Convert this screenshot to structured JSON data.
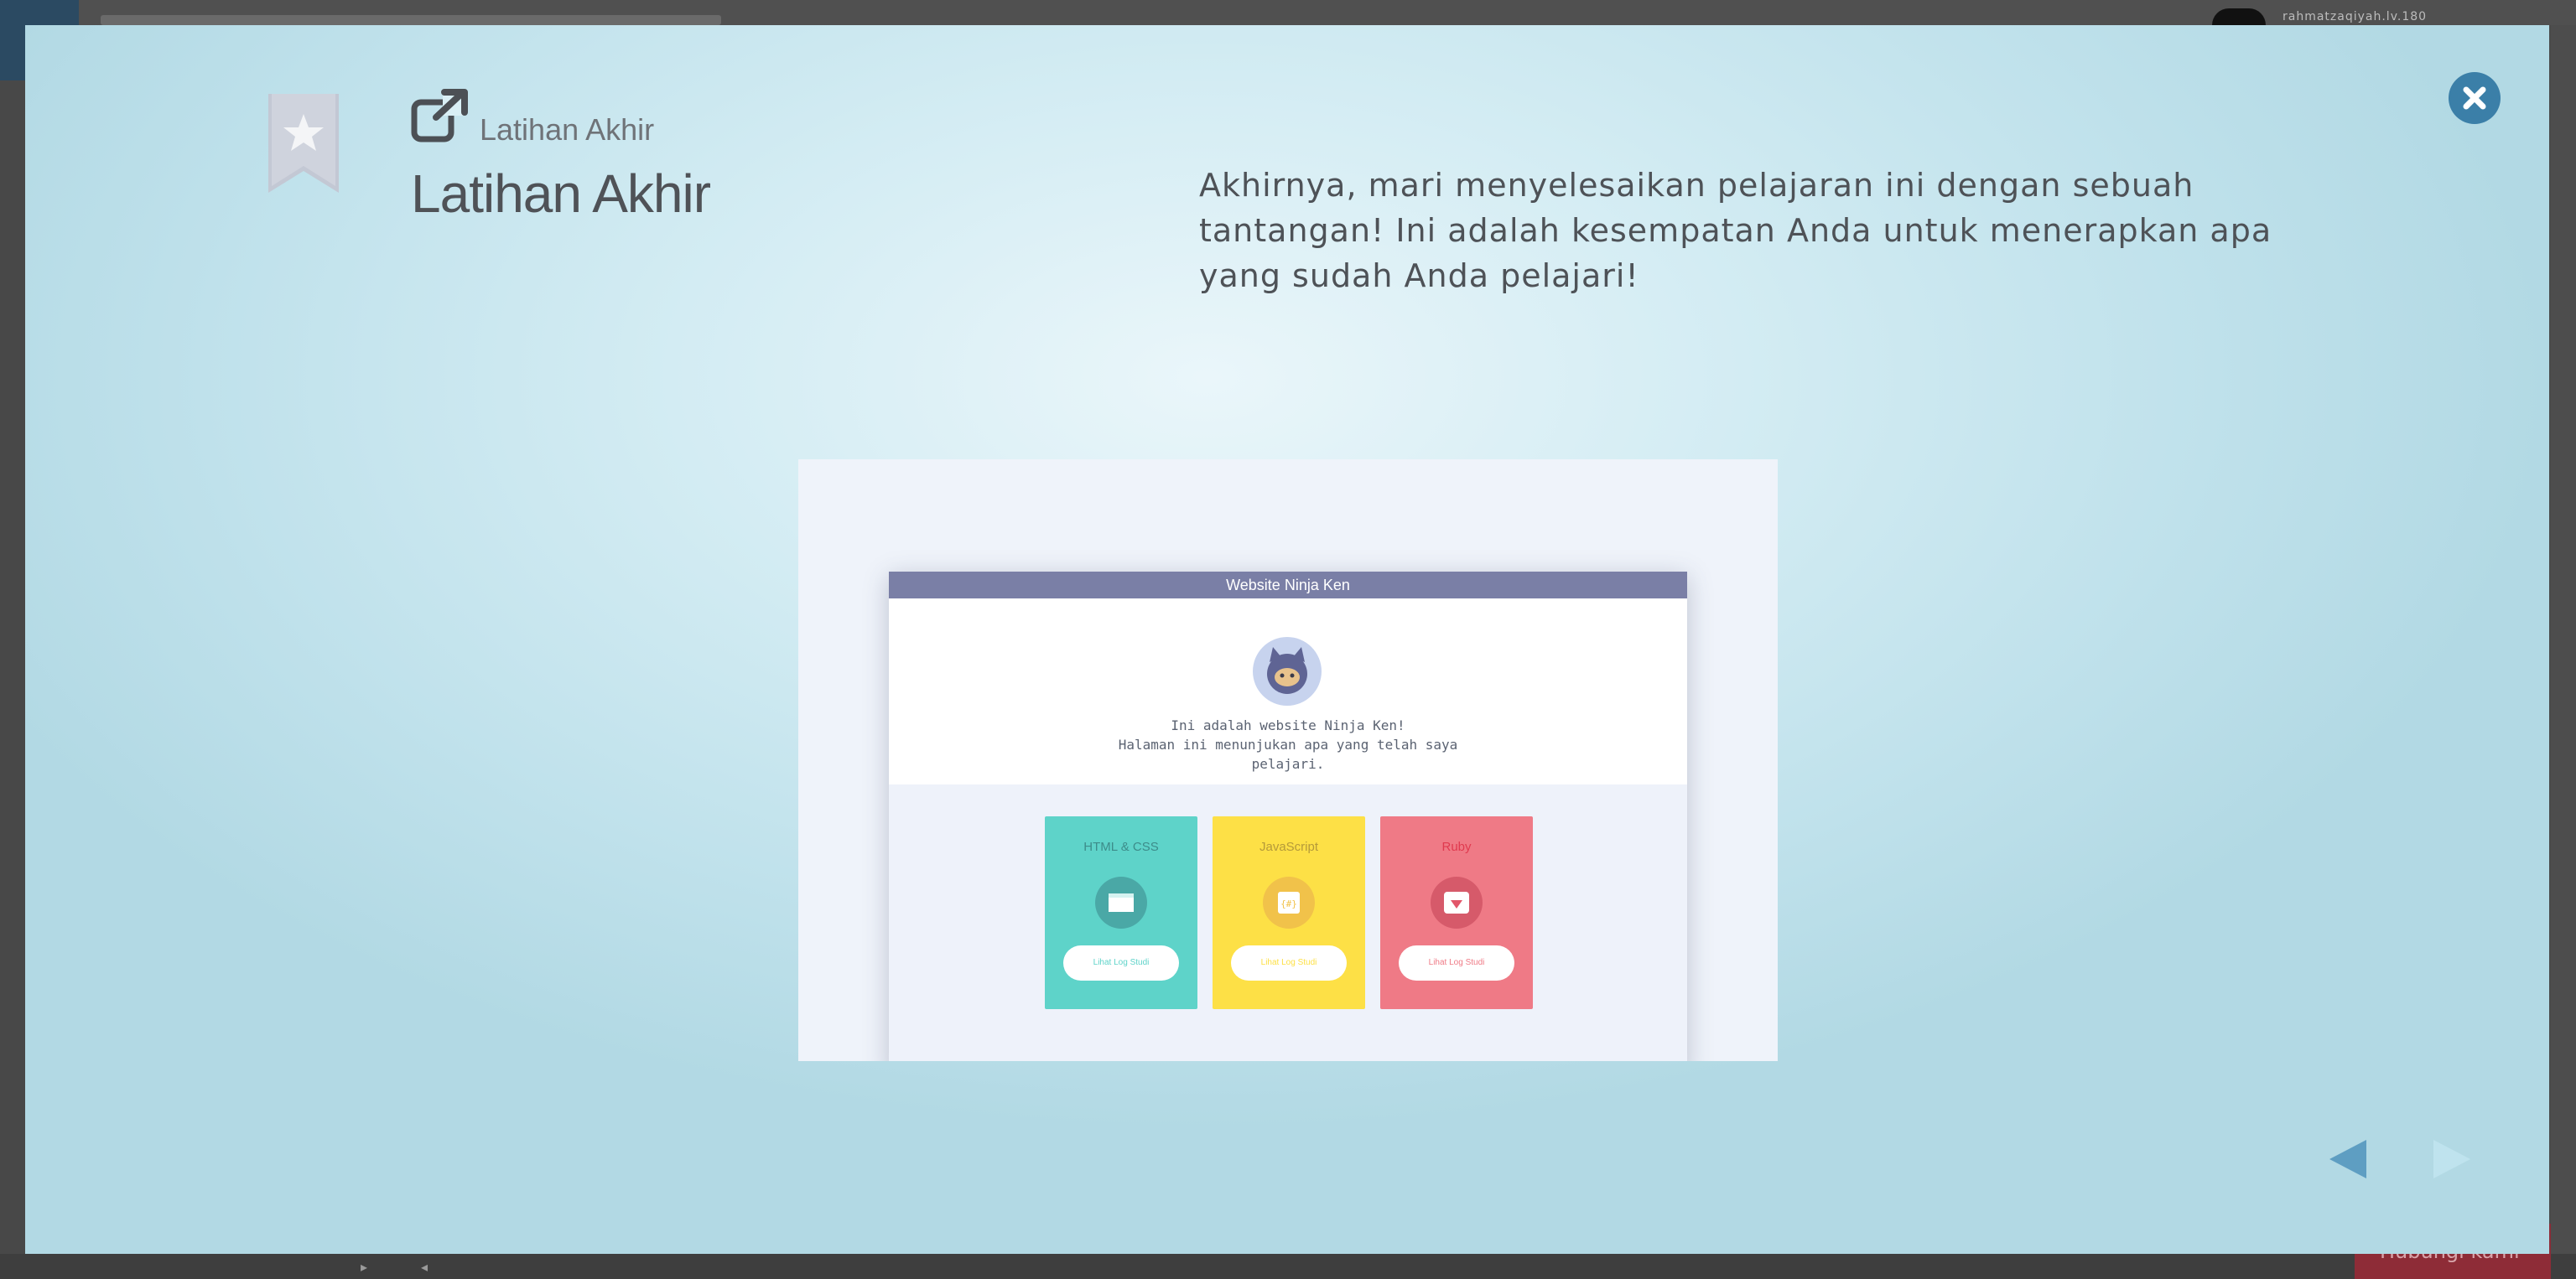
{
  "background": {
    "username": "rahmatzaqiyah.lv.180",
    "red_button_label": "Hubungi kami"
  },
  "modal": {
    "subtitle": "Latihan Akhir",
    "title": "Latihan Akhir",
    "description": "Akhirnya, mari menyelesaikan pelajaran ini dengan sebuah tantangan! Ini adalah kesempatan Anda untuk menerapkan apa yang sudah Anda pelajari!",
    "icons": {
      "bookmark": "bookmark-star-icon",
      "external": "external-link-icon",
      "close": "close-icon",
      "prev": "arrow-left-icon",
      "next": "arrow-right-icon"
    }
  },
  "preview": {
    "header": "Website Ninja Ken",
    "intro_line1": "Ini adalah website Ninja Ken!",
    "intro_line2": "Halaman ini menunjukan apa yang telah saya",
    "intro_line3": "pelajari.",
    "cards": [
      {
        "title": "HTML & CSS",
        "button": "Lihat Log Studi",
        "color": "#5ed3c9",
        "accent": "#4aa8a6"
      },
      {
        "title": "JavaScript",
        "button": "Lihat Log Studi",
        "color": "#fde046",
        "accent": "#f1c24a"
      },
      {
        "title": "Ruby",
        "button": "Lihat Log Studi",
        "color": "#ef7a86",
        "accent": "#d65a6a"
      }
    ]
  },
  "colors": {
    "close_button": "#3b7fa8",
    "nav_prev": "#5e9ec2",
    "nav_next_disabled": "#bfe3ee"
  }
}
